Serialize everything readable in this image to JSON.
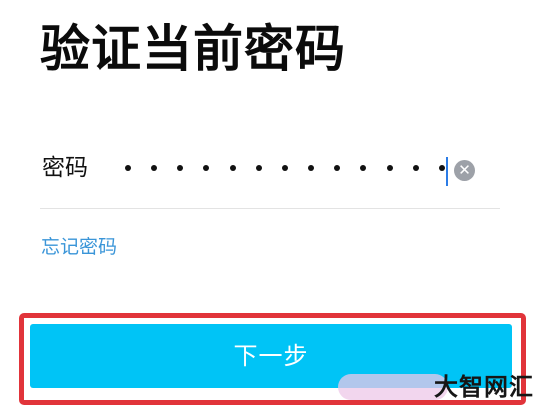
{
  "page": {
    "title": "验证当前密码"
  },
  "password_field": {
    "label": "密码",
    "masked_value": "•••••••••••••",
    "clear_icon": "close-circle-icon",
    "cursor_color": "#2c7ce6"
  },
  "forgot_link": {
    "label": "忘记密码",
    "color": "#3a95d8"
  },
  "next_button": {
    "label": "下一步",
    "background": "#00c4f6",
    "highlight_border": "#e1343a"
  },
  "watermark": {
    "text": "大智网汇"
  }
}
